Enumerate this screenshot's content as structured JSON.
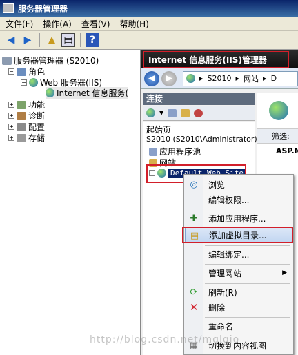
{
  "window": {
    "title": "服务器管理器"
  },
  "menu": [
    "文件(F)",
    "操作(A)",
    "查看(V)",
    "帮助(H)"
  ],
  "tree": {
    "root": "服务器管理器 (S2010)",
    "roles": "角色",
    "web": "Web 服务器(IIS)",
    "iis": "Internet 信息服务(",
    "features": "功能",
    "diagnostics": "诊断",
    "config": "配置",
    "storage": "存储"
  },
  "iis": {
    "header": "Internet 信息服务(IIS)管理器",
    "crumbs": [
      "S2010",
      "网站",
      "D"
    ],
    "connections_title": "连接",
    "start_page": "起始页",
    "server": "S2010 (S2010\\Administrator)",
    "app_pools": "应用程序池",
    "sites": "网站",
    "default_site": "Default Web Site",
    "filter_label": "筛选:",
    "feature_item": "ASP.N"
  },
  "context_menu": {
    "browse": "浏览",
    "edit_perms": "编辑权限...",
    "add_app": "添加应用程序...",
    "add_vdir": "添加虚拟目录...",
    "edit_bindings": "编辑绑定...",
    "manage_site": "管理网站",
    "refresh": "刷新(R)",
    "delete": "删除",
    "rename": "重命名",
    "switch_view": "切换到内容视图"
  },
  "watermark": "http://blog.csdn.net/mglgio",
  "colors": {
    "highlight_red": "#d21f2a",
    "menu_selection": "#c2d6f1"
  }
}
